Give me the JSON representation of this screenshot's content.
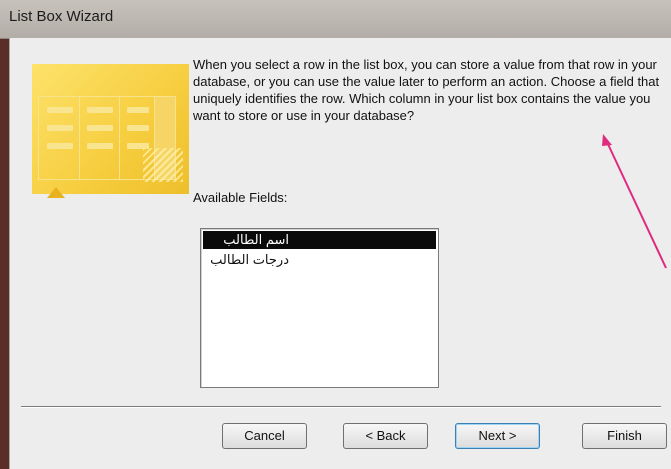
{
  "window": {
    "title": "List Box Wizard"
  },
  "wizard": {
    "description": "When you select a row in the list box, you can store a value from that row in your database, or you can use the value later to perform an action.  Choose a field that uniquely identifies the row. Which column in your list box contains the value you want to store or use in your database?",
    "available_fields_label": "Available Fields:",
    "fields": [
      {
        "label": "اسم الطالب",
        "selected": true
      },
      {
        "label": "درجات الطالب",
        "selected": false
      }
    ]
  },
  "buttons": {
    "cancel": "Cancel",
    "back": "< Back",
    "next": "Next >",
    "finish": "Finish"
  },
  "colors": {
    "annotation_arrow": "#e0297f",
    "selection": "#0a0a0a",
    "illustration": "#f6cd3e"
  }
}
